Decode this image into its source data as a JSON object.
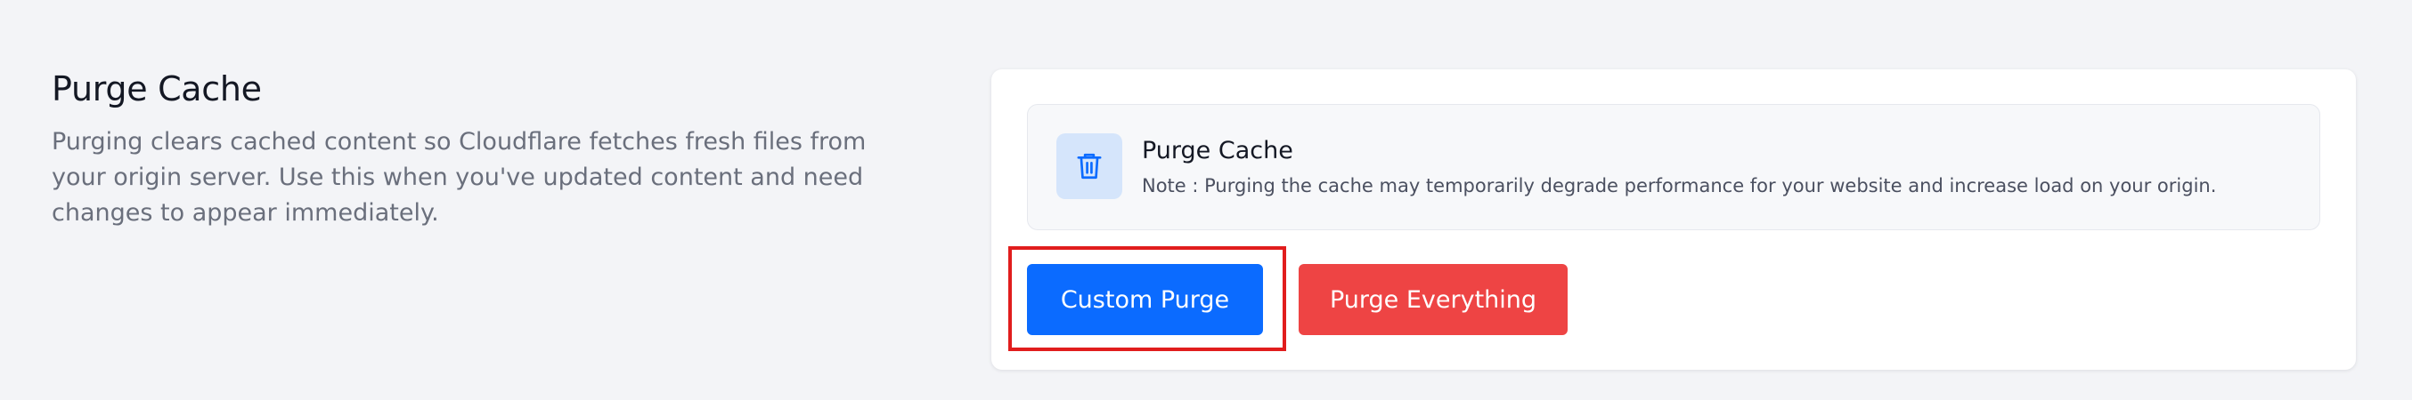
{
  "section": {
    "title": "Purge Cache",
    "description": "Purging clears cached content so Cloudflare fetches fresh files from your origin server. Use this when you've updated content and need changes to appear immediately."
  },
  "notice": {
    "icon": "trash-icon",
    "title": "Purge Cache",
    "note": "Note :  Purging the cache may temporarily degrade performance for your website and increase load on your origin."
  },
  "actions": {
    "custom_purge_label": "Custom Purge",
    "purge_everything_label": "Purge Everything"
  },
  "colors": {
    "page_background": "#f3f4f7",
    "primary": "#0b6bff",
    "danger": "#ee4444",
    "highlight_border": "#e11d1d",
    "icon_tile": "#d5e5fb",
    "icon_stroke": "#0b6bff"
  }
}
